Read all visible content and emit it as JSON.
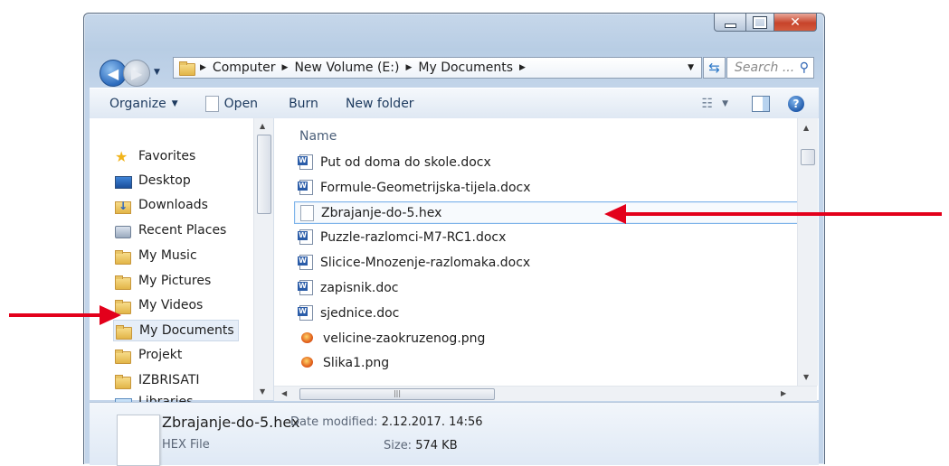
{
  "address": {
    "crumbs": [
      "Computer",
      "New Volume (E:)",
      "My Documents"
    ]
  },
  "search": {
    "placeholder": "Search ..."
  },
  "toolbar": {
    "organize": "Organize",
    "open": "Open",
    "burn": "Burn",
    "new_folder": "New folder"
  },
  "nav": {
    "items": [
      {
        "label": "Favorites",
        "icon": "star-icon"
      },
      {
        "label": "Desktop",
        "icon": "desktop-icon"
      },
      {
        "label": "Downloads",
        "icon": "downloads-folder-icon"
      },
      {
        "label": "Recent Places",
        "icon": "recent-places-icon"
      },
      {
        "label": "My Music",
        "icon": "folder-icon"
      },
      {
        "label": "My Pictures",
        "icon": "folder-icon"
      },
      {
        "label": "My Videos",
        "icon": "folder-icon"
      },
      {
        "label": "My Documents",
        "icon": "folder-icon",
        "selected": true
      },
      {
        "label": "Projekt",
        "icon": "folder-icon"
      },
      {
        "label": "IZBRISATI",
        "icon": "folder-icon"
      },
      {
        "label": "Libraries",
        "icon": "libraries-icon"
      }
    ]
  },
  "files": {
    "column_header": "Name",
    "items": [
      {
        "name": "Put od doma do skole.docx",
        "icon": "word-doc-icon"
      },
      {
        "name": "Formule-Geometrijska-tijela.docx",
        "icon": "word-doc-icon"
      },
      {
        "name": "Zbrajanje-do-5.hex",
        "icon": "blank-file-icon",
        "selected": true
      },
      {
        "name": "Puzzle-razlomci-M7-RC1.docx",
        "icon": "word-doc-icon"
      },
      {
        "name": "Slicice-Mnozenje-razlomaka.docx",
        "icon": "word-doc-icon"
      },
      {
        "name": "zapisnik.doc",
        "icon": "word-doc-icon"
      },
      {
        "name": "sjednice.doc",
        "icon": "word-doc-icon"
      },
      {
        "name": "velicine-zaokruzenog.png",
        "icon": "image-file-icon"
      },
      {
        "name": "Slika1.png",
        "icon": "image-file-icon"
      }
    ]
  },
  "details": {
    "name": "Zbrajanje-do-5.hex",
    "type": "HEX File",
    "date_label": "Date modified:",
    "date_value": "2.12.2017. 14:56",
    "size_label": "Size:",
    "size_value": "574 KB"
  },
  "colors": {
    "accent_arrow": "#e3001b",
    "selection_border": "#7eb4ea",
    "close_button": "#c7432a"
  }
}
